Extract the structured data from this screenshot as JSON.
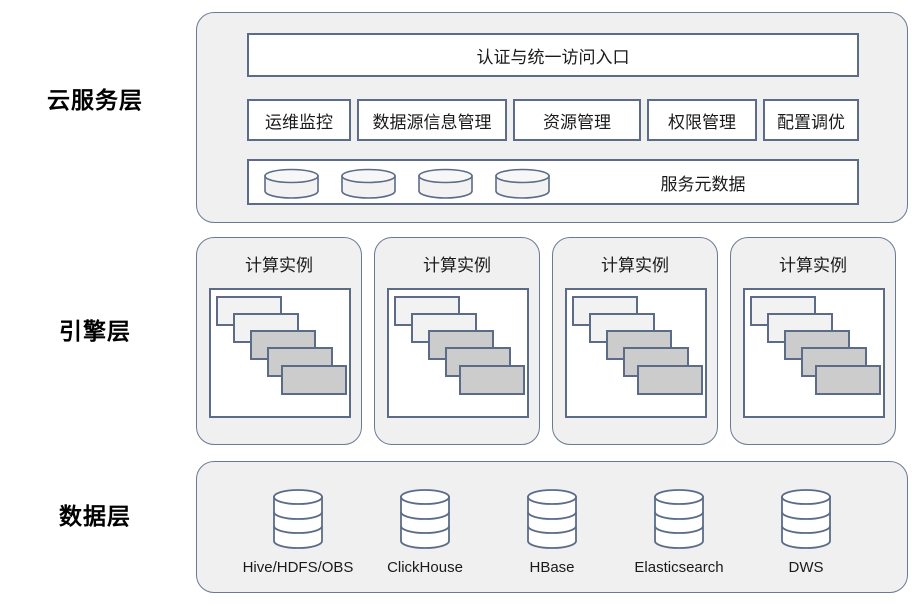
{
  "layers": [
    {
      "id": "cloud",
      "label": "云服务层"
    },
    {
      "id": "engine",
      "label": "引擎层"
    },
    {
      "id": "data",
      "label": "数据层"
    }
  ],
  "cloud_layer": {
    "auth_portal": "认证与统一访问入口",
    "modules": [
      "运维监控",
      "数据源信息管理",
      "资源管理",
      "权限管理",
      "配置调优"
    ],
    "metadata_bar": {
      "label": "服务元数据",
      "cylinder_count": 4,
      "cylinder_icon": "database-cylinder-icon"
    }
  },
  "engine_layer": {
    "instances": [
      {
        "title": "计算实例"
      },
      {
        "title": "计算实例"
      },
      {
        "title": "计算实例"
      },
      {
        "title": "计算实例"
      }
    ],
    "tasks_per_instance": 5,
    "task_shades": [
      "light",
      "light",
      "gray",
      "gray",
      "gray"
    ]
  },
  "data_layer": {
    "stores": [
      {
        "name": "Hive/HDFS/OBS",
        "icon": "database-cylinder-icon"
      },
      {
        "name": "ClickHouse",
        "icon": "database-cylinder-icon"
      },
      {
        "name": "HBase",
        "icon": "database-cylinder-icon"
      },
      {
        "name": "Elasticsearch",
        "icon": "database-cylinder-icon"
      },
      {
        "name": "DWS",
        "icon": "database-cylinder-icon"
      }
    ]
  },
  "colors": {
    "shell_fill": "#f0f0f0",
    "shell_border": "#6b7a94",
    "box_border": "#5c6c88",
    "box_fill": "#ffffff",
    "task_light": "#f2f2f2",
    "task_gray": "#cccccc",
    "text": "#1a1a1a",
    "background": "#ffffff"
  }
}
